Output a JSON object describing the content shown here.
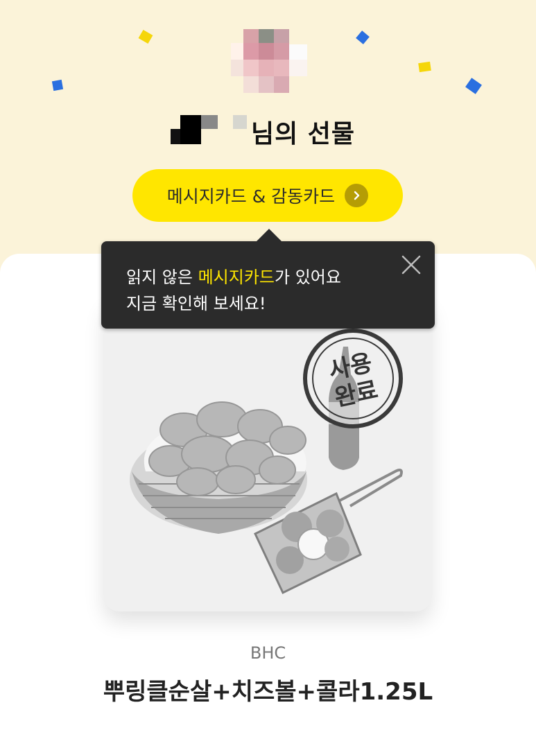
{
  "header": {
    "title_suffix": "님의 선물"
  },
  "message_button": {
    "label": "메시지카드 & 감동카드",
    "icon": "chevron-right-icon"
  },
  "tooltip": {
    "line1_prefix": "읽지 않은 ",
    "line1_highlight": "메시지카드",
    "line1_suffix": "가 있어요",
    "line2": "지금 확인해 보세요!"
  },
  "stamp": {
    "line1": "사용",
    "line2": "완료"
  },
  "product": {
    "brand": "BHC",
    "name": "뿌링클순살+치즈볼+콜라1.25L"
  },
  "colors": {
    "background": "#fbf3d9",
    "accent_yellow": "#ffe600",
    "tooltip_bg": "#2b2b2b"
  }
}
